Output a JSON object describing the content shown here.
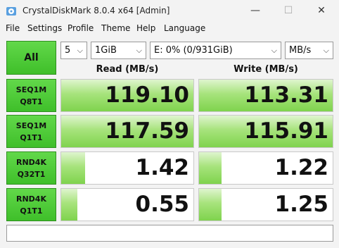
{
  "window": {
    "title": "CrystalDiskMark 8.0.4 x64 [Admin]",
    "minimize_glyph": "—",
    "maximize_glyph": "☐",
    "close_glyph": "✕"
  },
  "menu": [
    "File",
    "Settings",
    "Profile",
    "Theme",
    "Help",
    "Language"
  ],
  "controls": {
    "all_label": "All",
    "count": "5",
    "size": "1GiB",
    "drive": "E: 0% (0/931GiB)",
    "unit": "MB/s",
    "chevron": "⌵"
  },
  "headers": {
    "read": "Read (MB/s)",
    "write": "Write (MB/s)"
  },
  "tests": [
    {
      "line1": "SEQ1M",
      "line2": "Q8T1",
      "read": "119.10",
      "write": "113.31",
      "read_fill": 1.0,
      "write_fill": 1.0
    },
    {
      "line1": "SEQ1M",
      "line2": "Q1T1",
      "read": "117.59",
      "write": "115.91",
      "read_fill": 1.0,
      "write_fill": 1.0
    },
    {
      "line1": "RND4K",
      "line2": "Q32T1",
      "read": "1.42",
      "write": "1.22",
      "read_fill": 0.18,
      "write_fill": 0.17
    },
    {
      "line1": "RND4K",
      "line2": "Q1T1",
      "read": "0.55",
      "write": "1.25",
      "read_fill": 0.12,
      "write_fill": 0.17
    }
  ],
  "status": "",
  "colors": {
    "accent_green": "#3fbf2a",
    "fill_green": "#7fd34d"
  }
}
